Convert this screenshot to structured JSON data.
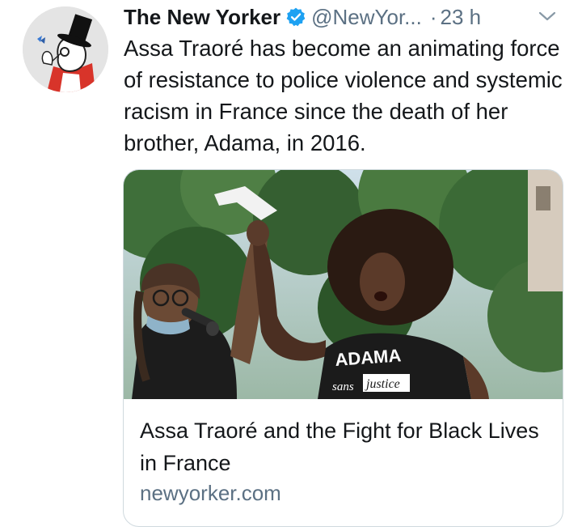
{
  "tweet": {
    "author_name": "The New Yorker",
    "handle": "@NewYor...",
    "separator": "·",
    "time": "23 h",
    "text": "Assa Traoré has become an animating force of resistance to police violence and systemic racism in France since the death of her brother, Adama, in 2016.",
    "verified_icon": "verified-badge-icon",
    "menu_icon": "chevron-down-icon"
  },
  "card": {
    "title": "Assa Traoré and the Fight for Black Lives in France",
    "domain": "newyorker.com",
    "image": {
      "shirt_text_1": "ADAMA",
      "shirt_text_2": "sans",
      "shirt_text_3": "justice"
    }
  },
  "colors": {
    "verified": "#1da1f2",
    "secondary_text": "#5b7083",
    "primary_text": "#14171a",
    "card_border": "#cfd9de"
  }
}
